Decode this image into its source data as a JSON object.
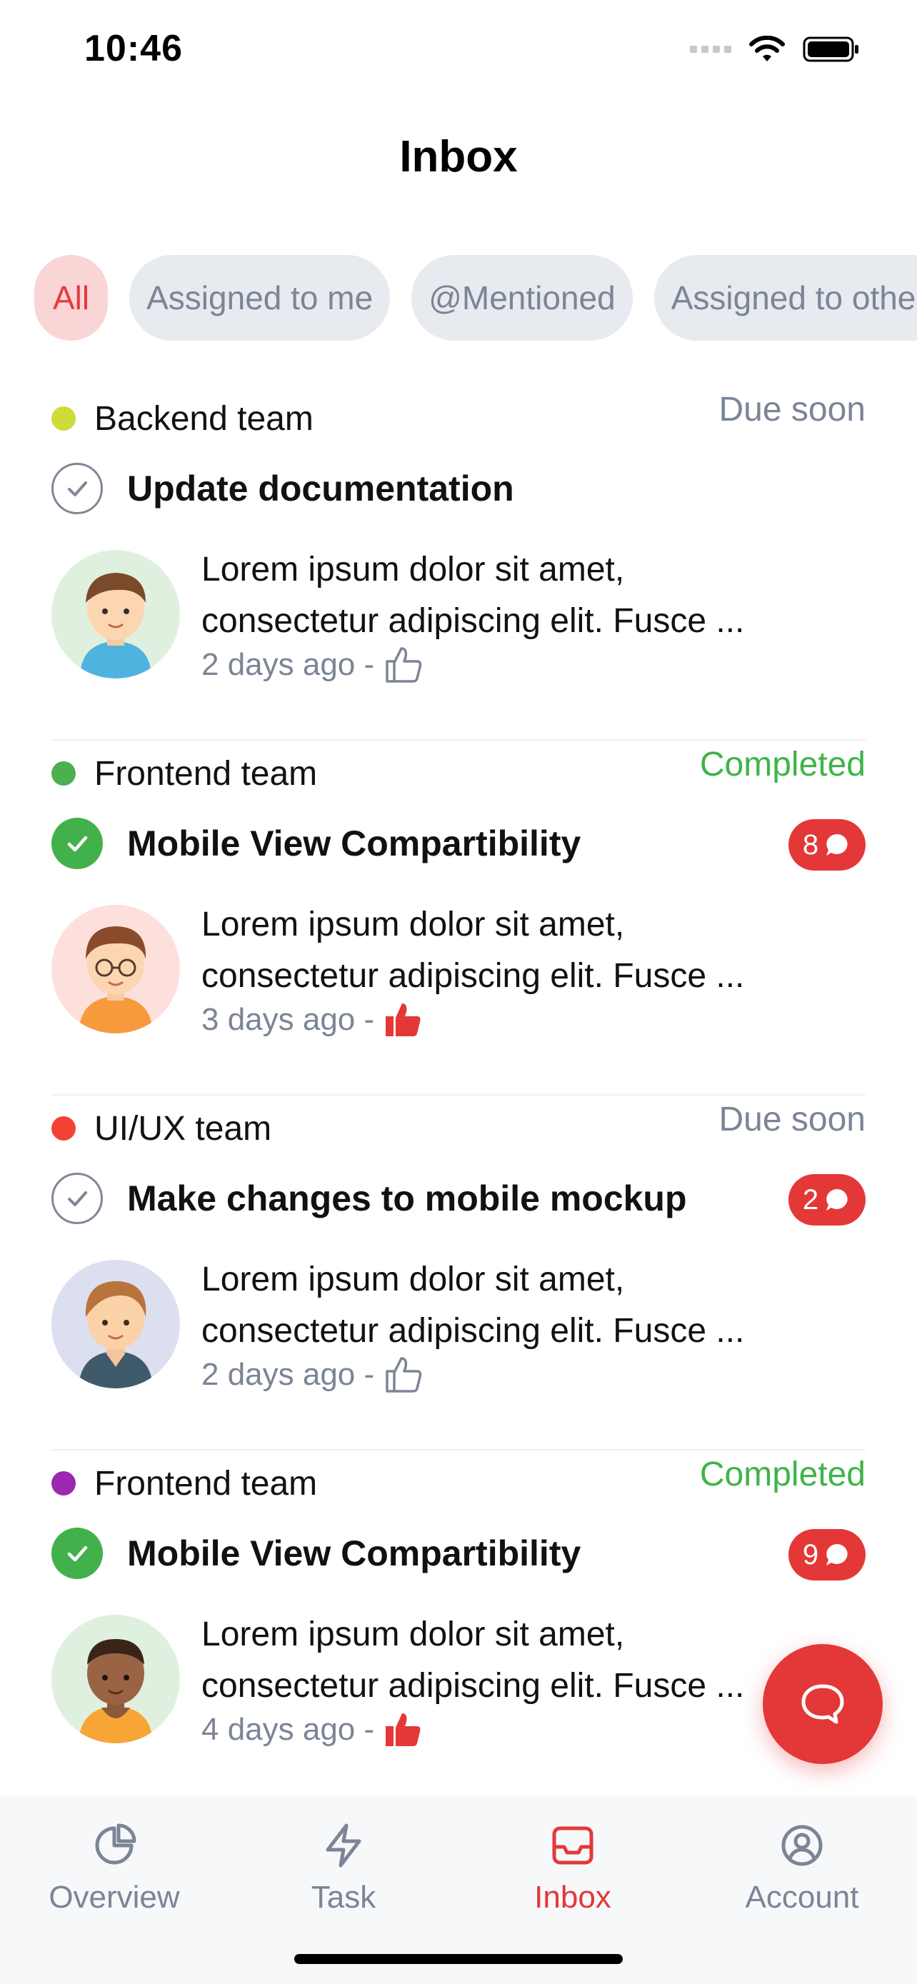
{
  "status_bar": {
    "time": "10:46"
  },
  "header": {
    "title": "Inbox"
  },
  "filters": [
    {
      "label": "All",
      "active": true
    },
    {
      "label": "Assigned to me",
      "active": false
    },
    {
      "label": "@Mentioned",
      "active": false
    },
    {
      "label": "Assigned to others",
      "active": false
    }
  ],
  "items": [
    {
      "team": "Backend team",
      "team_color": "#cddc39",
      "status": "Due soon",
      "completed": false,
      "title": "Update documentation",
      "comments": "",
      "body_line1": "Lorem ipsum dolor sit amet,",
      "body_line2": "consectetur adipiscing elit. Fusce ...",
      "time": "2 days ago -",
      "liked": false,
      "avatar_bg": "#e0f0df"
    },
    {
      "team": "Frontend team",
      "team_color": "#4caf50",
      "status": "Completed",
      "completed": true,
      "title": "Mobile View Compartibility",
      "comments": "8",
      "body_line1": "Lorem ipsum dolor sit amet,",
      "body_line2": "consectetur adipiscing elit. Fusce ...",
      "time": "3 days ago -",
      "liked": true,
      "avatar_bg": "#fde0dc"
    },
    {
      "team": "UI/UX team",
      "team_color": "#f44336",
      "status": "Due soon",
      "completed": false,
      "title": "Make changes to mobile mockup",
      "comments": "2",
      "body_line1": "Lorem ipsum dolor sit amet,",
      "body_line2": "consectetur adipiscing elit. Fusce ...",
      "time": "2 days ago -",
      "liked": false,
      "avatar_bg": "#dcdff0"
    },
    {
      "team": "Frontend team",
      "team_color": "#9c27b0",
      "status": "Completed",
      "completed": true,
      "title": "Mobile View Compartibility",
      "comments": "9",
      "body_line1": "Lorem ipsum dolor sit amet,",
      "body_line2": "consectetur adipiscing elit. Fusce ...",
      "time": "4 days ago -",
      "liked": true,
      "avatar_bg": "#e0f0df"
    }
  ],
  "nav": [
    {
      "label": "Overview",
      "icon": "pie-chart-icon",
      "active": false
    },
    {
      "label": "Task",
      "icon": "lightning-icon",
      "active": false
    },
    {
      "label": "Inbox",
      "icon": "inbox-tray-icon",
      "active": true
    },
    {
      "label": "Account",
      "icon": "user-circle-icon",
      "active": false
    }
  ],
  "colors": {
    "accent": "#e43838",
    "completed": "#3fb449",
    "muted": "#7b8596"
  }
}
